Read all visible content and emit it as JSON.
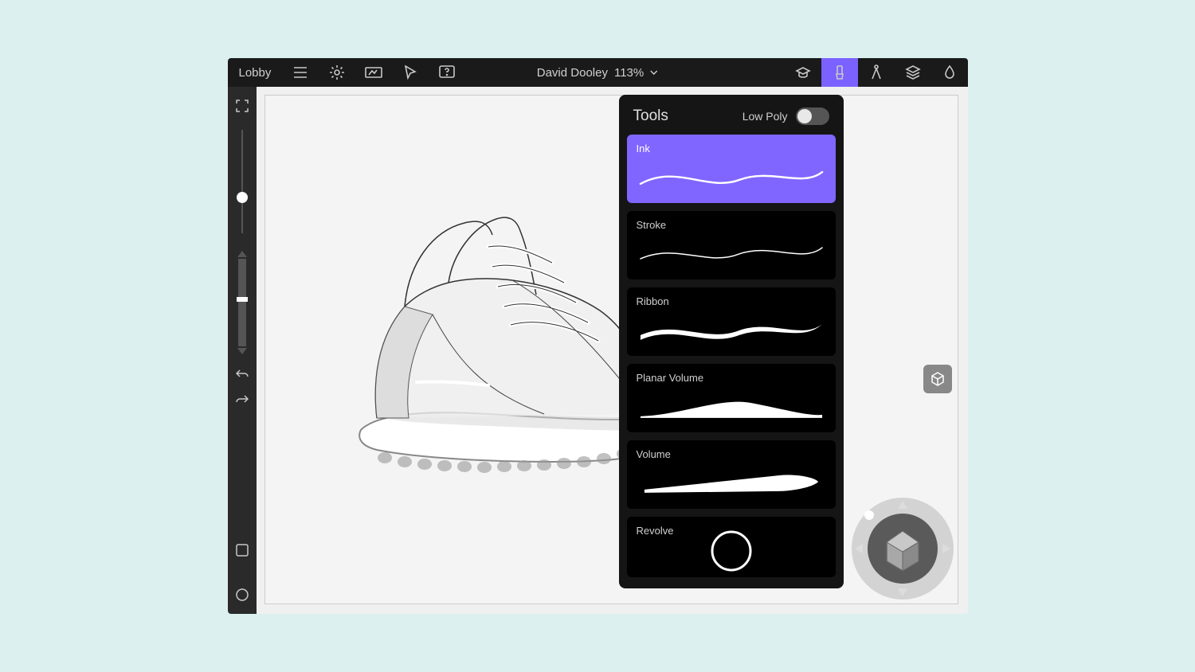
{
  "topbar": {
    "lobby": "Lobby",
    "document_title": "David Dooley",
    "zoom": "113%"
  },
  "tools_panel": {
    "title": "Tools",
    "lowpoly_label": "Low Poly",
    "lowpoly_on": false,
    "items": [
      {
        "label": "Ink",
        "selected": true
      },
      {
        "label": "Stroke",
        "selected": false
      },
      {
        "label": "Ribbon",
        "selected": false
      },
      {
        "label": "Planar Volume",
        "selected": false
      },
      {
        "label": "Volume",
        "selected": false
      },
      {
        "label": "Revolve",
        "selected": false
      }
    ]
  },
  "colors": {
    "accent": "#8066ff",
    "panel_bg": "#151515",
    "app_bg": "#1a1a1a"
  }
}
